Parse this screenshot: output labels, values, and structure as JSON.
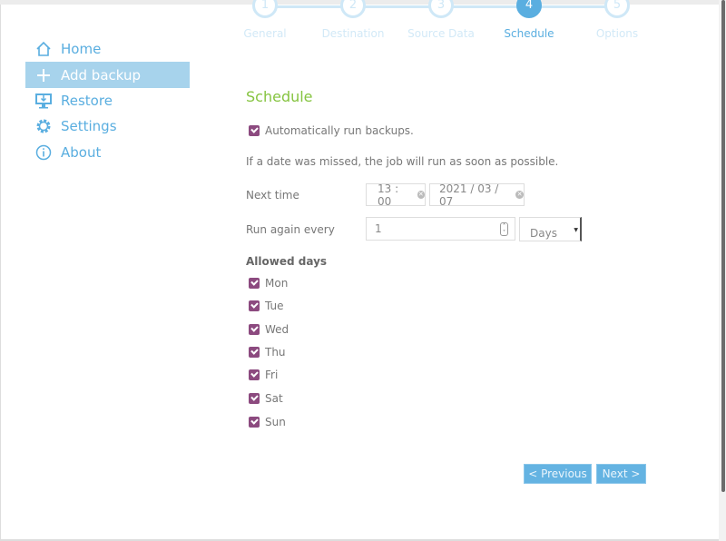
{
  "sidebar": {
    "items": [
      {
        "label": "Home",
        "icon": "home-icon"
      },
      {
        "label": "Add backup",
        "icon": "plus-icon",
        "active": true
      },
      {
        "label": "Restore",
        "icon": "restore-monitor-icon"
      },
      {
        "label": "Settings",
        "icon": "gear-icon"
      },
      {
        "label": "About",
        "icon": "info-icon"
      }
    ]
  },
  "wizard": {
    "current_step": 4,
    "steps": [
      {
        "num": "1",
        "label": "General"
      },
      {
        "num": "2",
        "label": "Destination"
      },
      {
        "num": "3",
        "label": "Source Data"
      },
      {
        "num": "4",
        "label": "Schedule"
      },
      {
        "num": "5",
        "label": "Options"
      }
    ]
  },
  "schedule": {
    "title": "Schedule",
    "auto_run_label": "Automatically run backups.",
    "auto_run_checked": true,
    "missed_note": "If a date was missed, the job will run as soon as possible.",
    "next_time_label": "Next time",
    "time_value": "13 : 00",
    "date_value": "2021 / 03 / 07",
    "run_again_label": "Run again every",
    "interval_value": "1",
    "interval_unit": "Days",
    "allowed_days_label": "Allowed days",
    "days": [
      {
        "label": "Mon",
        "checked": true
      },
      {
        "label": "Tue",
        "checked": true
      },
      {
        "label": "Wed",
        "checked": true
      },
      {
        "label": "Thu",
        "checked": true
      },
      {
        "label": "Fri",
        "checked": true
      },
      {
        "label": "Sat",
        "checked": true
      },
      {
        "label": "Sun",
        "checked": true
      }
    ]
  },
  "buttons": {
    "previous": "< Previous",
    "next": "Next >"
  },
  "colors": {
    "accent": "#5aaee0",
    "title": "#86c441",
    "checkbox": "#8c4a7f"
  }
}
